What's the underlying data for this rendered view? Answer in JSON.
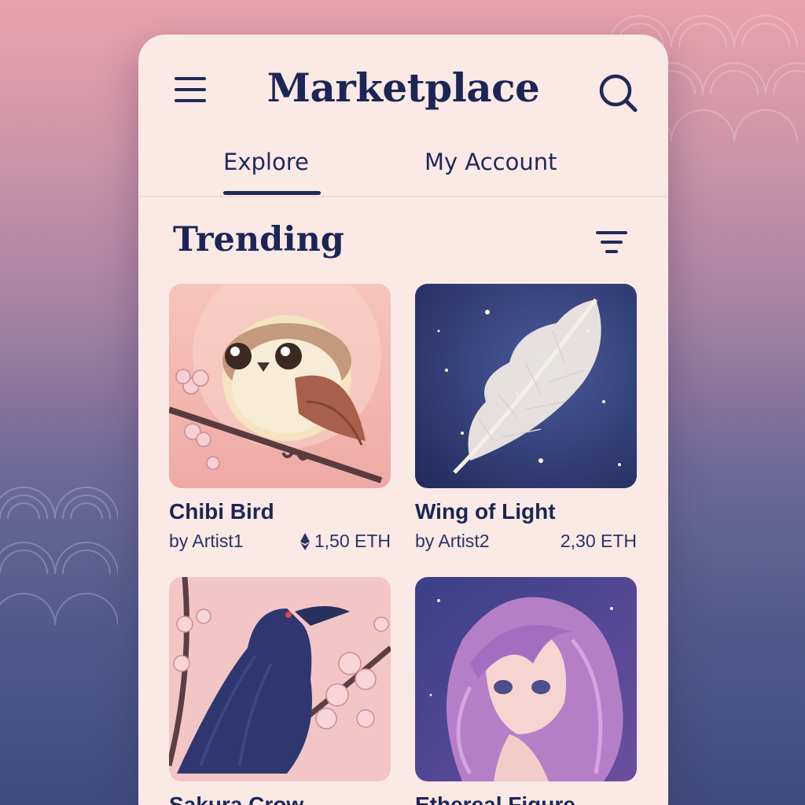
{
  "header": {
    "title": "Marketplace",
    "menu_icon": "hamburger-menu-icon",
    "search_icon": "search-icon"
  },
  "tabs": [
    {
      "label": "Explore",
      "active": true
    },
    {
      "label": "My Account",
      "active": false
    }
  ],
  "section": {
    "title": "Trending",
    "filter_icon": "filter-icon"
  },
  "items": [
    {
      "name": "Chibi Bird",
      "artist": "by Artist1",
      "price": "1,50 ETH",
      "show_eth_icon": true
    },
    {
      "name": "Wing of Light",
      "artist": "by Artist2",
      "price": "2,30 ETH",
      "show_eth_icon": false
    },
    {
      "name": "Sakura Crow",
      "artist": "",
      "price": ""
    },
    {
      "name": "Ethereal Figure",
      "artist": "",
      "price": ""
    }
  ],
  "colors": {
    "accent": "#1f2a5a",
    "panel": "#fbe9e6"
  }
}
